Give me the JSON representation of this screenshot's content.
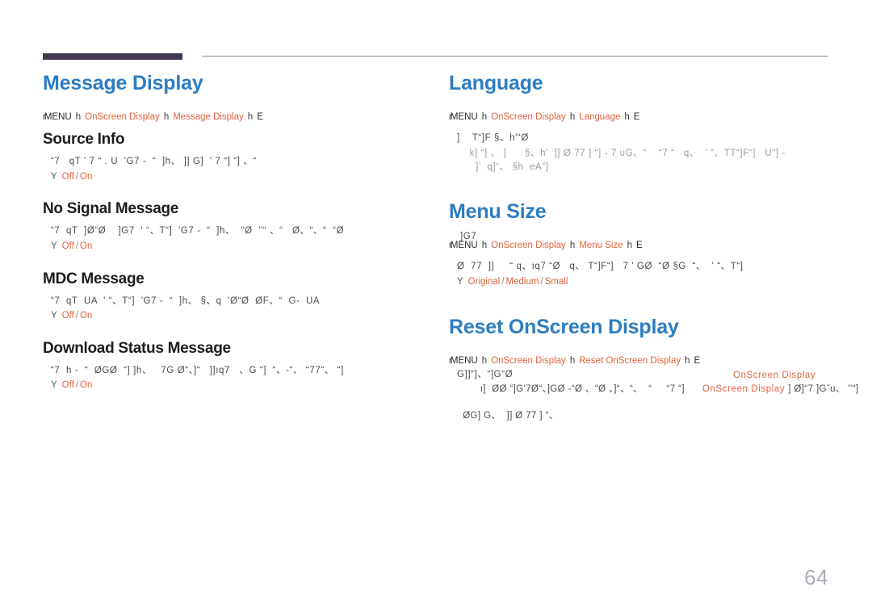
{
  "page": {
    "number": "64",
    "accent_blue": "#2d7cc0",
    "accent_orange": "#e2623f",
    "rule_dark": "#433a52",
    "body_gray": "#4a4a4a",
    "dim_gray": "#9a9aa2",
    "page_number_color": "#a8aeb8"
  },
  "left_column": {
    "section": {
      "title": "Message Display",
      "path": {
        "bullet": "r",
        "menu": "MENU",
        "arrow1": "h",
        "crumb1": "OnScreen Display",
        "arrow2": "h",
        "crumb2": "Message Display",
        "arrow3": "h",
        "tail": "E"
      }
    },
    "items": [
      {
        "title": "Source Info",
        "body": [
          "“7   qT ' 7 “ . U  'G7 -  “  ]h、 ]] G]  ' 7 “] “] 、“"
        ],
        "options": {
          "dash": "Y",
          "values": [
            "Off",
            "On"
          ],
          "separator": "/"
        }
      },
      {
        "title": "No Signal Message",
        "body": [
          "“7  qT  ]Ø“Ø    ]G7  ' “、T“]  'G7 -  “  ]h、  “Ø  ''“ 、“   Ø、“、“  “Ø"
        ],
        "options": {
          "dash": "Y",
          "values": [
            "Off",
            "On"
          ],
          "separator": "/"
        }
      },
      {
        "title": "MDC Message",
        "body": [
          "“7  qT  UA  ' “、T“]  'G7 -  “  ]h、 §、q  'Ø“Ø  ØF、“  G-  UA"
        ],
        "options": {
          "dash": "Y",
          "values": [
            "Off",
            "On"
          ],
          "separator": "/"
        }
      },
      {
        "title": "Download Status Message",
        "body": [
          "“7  h -  “  ØGØ  “] ]h、   7G Ø“、]“   ]]ıq7   、G “]  “、-“、 “77“、 “]"
        ],
        "options": {
          "dash": "Y",
          "values": [
            "Off",
            "On"
          ],
          "separator": "/"
        }
      }
    ]
  },
  "right_column": {
    "sections": [
      {
        "title": "Language",
        "path": {
          "bullet": "r",
          "menu": "MENU",
          "arrow1": "h",
          "crumb1": "OnScreen Display",
          "arrow2": "h",
          "crumb2": "Language",
          "arrow3": "h",
          "tail": "E"
        },
        "body": [
          "]    T“]F §、h'“Ø"
        ],
        "body_dim": [
          "  k] “] 、 ]      §、h'  ]] Ø 77 ] “] - 7 uG、“    “7 “   q、  ' “、TT“]F“]   U“] -",
          "    ]'  q]“、 §h  eA“]"
        ],
        "options": null
      },
      {
        "title": "Menu Size",
        "stray_fragment": "]G7",
        "path": {
          "bullet": "r",
          "menu": "MENU",
          "arrow1": "h",
          "crumb1": "OnScreen Display",
          "arrow2": "h",
          "crumb2": "Menu Size",
          "arrow3": "h",
          "tail": "E"
        },
        "body": [
          "Ø  77  ]]     “ q、ıq7 “Ø   q、 T“]F“]   7 ' GØ  “Ø §G  “、  ' “、T“]"
        ],
        "options": {
          "dash": "Y",
          "values": [
            "Original",
            "Medium",
            "Small"
          ],
          "separator": "/"
        }
      },
      {
        "title": "Reset OnScreen Display",
        "path": {
          "bullet": "r",
          "menu": "MENU",
          "arrow1": "h",
          "crumb1": "OnScreen Display",
          "arrow2": "h",
          "crumb2": "Reset OnScreen Display",
          "arrow3": "h",
          "tail": "E"
        },
        "stray_fragment_over": "G]]“]、“]G“Ø",
        "body": [
          "ı]  ØØ “]G'7Ø“、]GØ -“Ø 、“Ø 、]“、“、  “     “7 “]",
          "  ØG] G、  ]] Ø 77 ] “、"
        ],
        "inline_highlight_1": "OnScreen Display",
        "inline_highlight_2": "OnScreen Display",
        "body_tail": "] Ø]“7 ]Gˇu、 ''“]"
      }
    ]
  }
}
